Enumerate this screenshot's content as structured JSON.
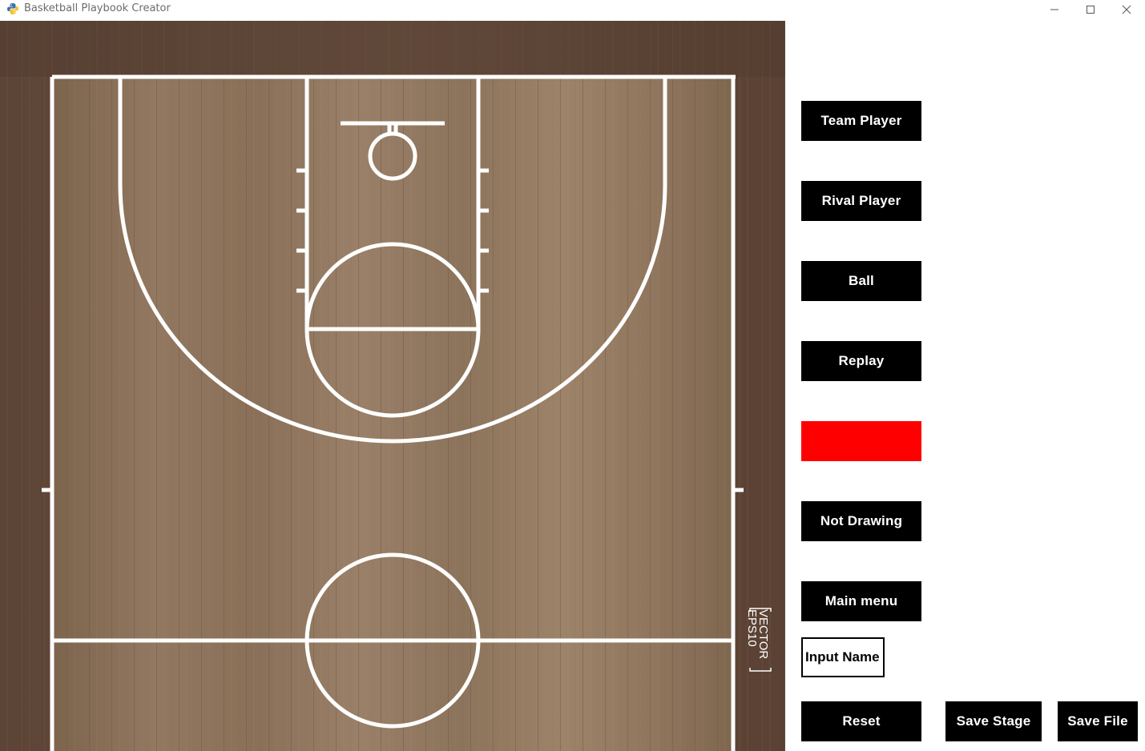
{
  "window": {
    "title": "Basketball Playbook Creator",
    "icon": "python-icon",
    "controls": [
      "minimize-icon",
      "maximize-icon",
      "close-icon"
    ]
  },
  "court": {
    "watermark_line1": "VECTOR",
    "watermark_line2": "EPS10"
  },
  "buttons": {
    "team_player": "Team Player",
    "rival_player": "Rival Player",
    "ball": "Ball",
    "replay": "Replay",
    "drawing_toggle": "Not Drawing",
    "main_menu": "Main menu",
    "reset": "Reset",
    "save_stage": "Save Stage",
    "save_file": "Save File"
  },
  "color_swatch": {
    "color": "#ff0000"
  },
  "name_input": {
    "placeholder": "Input Name",
    "value": ""
  },
  "colors": {
    "button_bg": "#000000",
    "button_text": "#ffffff",
    "court_wood": "#8c7257",
    "court_border": "#5a4133",
    "court_lines": "#ffffff"
  }
}
